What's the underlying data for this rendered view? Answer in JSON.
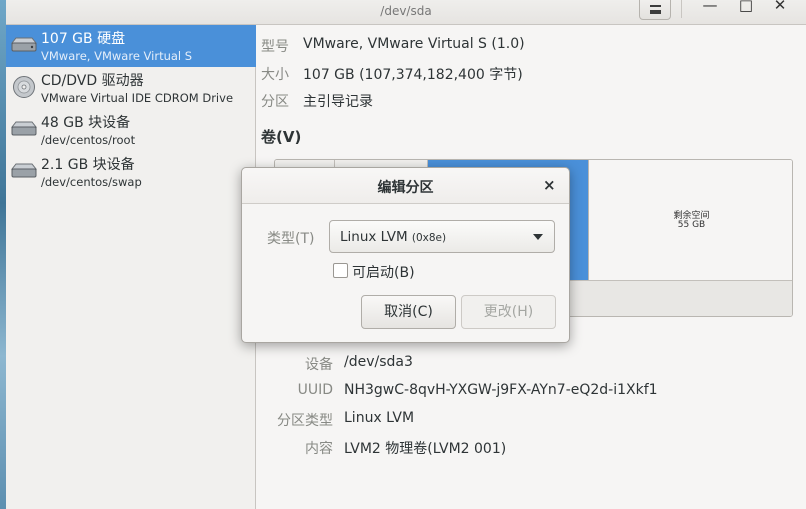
{
  "window": {
    "title": "/dev/sda"
  },
  "sidebar": {
    "devices": [
      {
        "name": "107 GB 硬盘",
        "sub": "VMware, VMware Virtual S",
        "icon": "hard-disk-icon",
        "selected": true
      },
      {
        "name": "CD/DVD 驱动器",
        "sub": "VMware Virtual IDE CDROM Drive",
        "icon": "optical-disc-icon",
        "selected": false
      },
      {
        "name": "48 GB 块设备",
        "sub": "/dev/centos/root",
        "icon": "block-device-icon",
        "selected": false
      },
      {
        "name": "2.1 GB 块设备",
        "sub": "/dev/centos/swap",
        "icon": "block-device-icon",
        "selected": false
      }
    ]
  },
  "disk_info": {
    "model_label": "型号",
    "model_value": "VMware, VMware Virtual S (1.0)",
    "size_label": "大小",
    "size_value": "107 GB (107,374,182,400 字节)",
    "partitioning_label": "分区",
    "partitioning_value": "主引导记录"
  },
  "volumes": {
    "title": "卷(V)",
    "free_space_label": "剩余空间",
    "free_space_size": "55 GB"
  },
  "partition_details": {
    "device_label": "设备",
    "device_value": "/dev/sda3",
    "uuid_label": "UUID",
    "uuid_value": "NH3gwC-8qvH-YXGW-j9FX-AYn7-eQ2d-i1Xkf1",
    "type_label": "分区类型",
    "type_value": "Linux LVM",
    "contents_label": "内容",
    "contents_value": "LVM2 物理卷(LVM2 001)"
  },
  "dialog": {
    "title": "编辑分区",
    "type_label": "类型(T)",
    "type_value": "Linux LVM",
    "type_code": "(0x8e)",
    "bootable_label": "可启动(B)",
    "bootable_checked": false,
    "cancel_label": "取消(C)",
    "change_label": "更改(H)",
    "close_glyph": "×"
  },
  "colors": {
    "accent": "#4a90d9",
    "window_bg": "#f6f5f4"
  }
}
